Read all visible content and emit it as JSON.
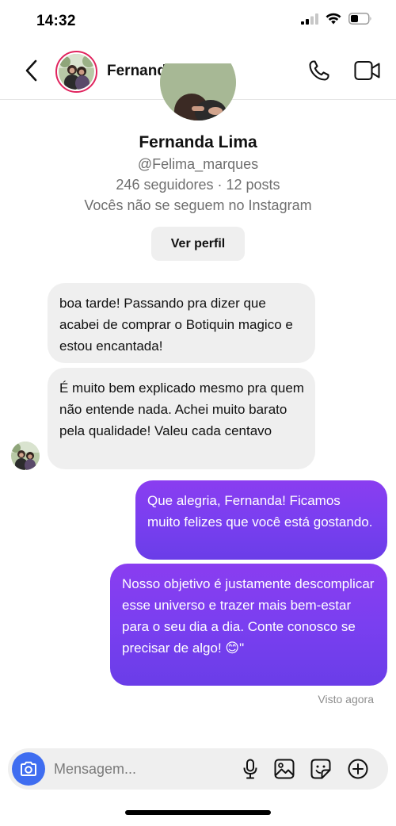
{
  "status_bar": {
    "time": "14:32"
  },
  "header": {
    "name": "Fernanda Lima"
  },
  "profile": {
    "name": "Fernanda Lima",
    "handle": "@Felima_marques",
    "stats": "246 seguidores · 12 posts",
    "note": "Vocês não se seguem no Instagram",
    "view_button": "Ver perfil"
  },
  "messages": [
    {
      "direction": "incoming",
      "text": "boa tarde! Passando pra dizer que acabei de comprar o Botiquin magico e estou encantada!"
    },
    {
      "direction": "incoming",
      "text": "É muito bem explicado mesmo pra quem não entende nada. Achei muito barato pela qualidade! Valeu cada centavo"
    },
    {
      "direction": "outgoing",
      "text": "Que alegria, Fernanda! Ficamos muito felizes que você está gostando."
    },
    {
      "direction": "outgoing",
      "text": "Nosso objetivo é justamente descomplicar esse universo e trazer mais bem-estar para o seu dia a dia. Conte conosco se precisar de algo! 😊\""
    }
  ],
  "seen_label": "Visto agora",
  "composer": {
    "placeholder": "Mensagem..."
  },
  "colors": {
    "outgoing_bubble": "#7a3ff0",
    "incoming_bubble": "#efefef",
    "camera_button": "#3f6df0",
    "story_ring": "#e0245e"
  }
}
